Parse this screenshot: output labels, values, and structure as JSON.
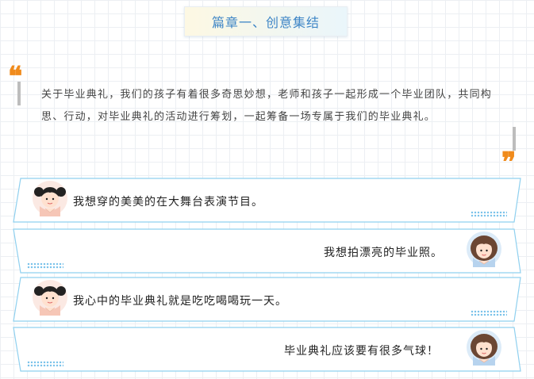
{
  "header": {
    "title": "篇章一、创意集结"
  },
  "intro": {
    "text": "关于毕业典礼，我们的孩子有着很多奇思妙想，老师和孩子一起形成一个毕业团队，共同构思、行动，对毕业典礼的活动进行筹划，一起筹备一场专属于我们的毕业典礼。"
  },
  "colors": {
    "accent": "#3f86c6",
    "quote": "#f08b1c",
    "border": "#8fd0ef"
  },
  "cards": [
    {
      "text": "我想穿的美美的在大舞台表演节目。",
      "avatar": "girl-pigtails-icon",
      "side": "left"
    },
    {
      "text": "我想拍漂亮的毕业照。",
      "avatar": "girl-curly-icon",
      "side": "right"
    },
    {
      "text": "我心中的毕业典礼就是吃吃喝喝玩一天。",
      "avatar": "girl-pigtails-icon",
      "side": "left"
    },
    {
      "text": "毕业典礼应该要有很多气球！",
      "avatar": "girl-curly-icon",
      "side": "right"
    }
  ]
}
